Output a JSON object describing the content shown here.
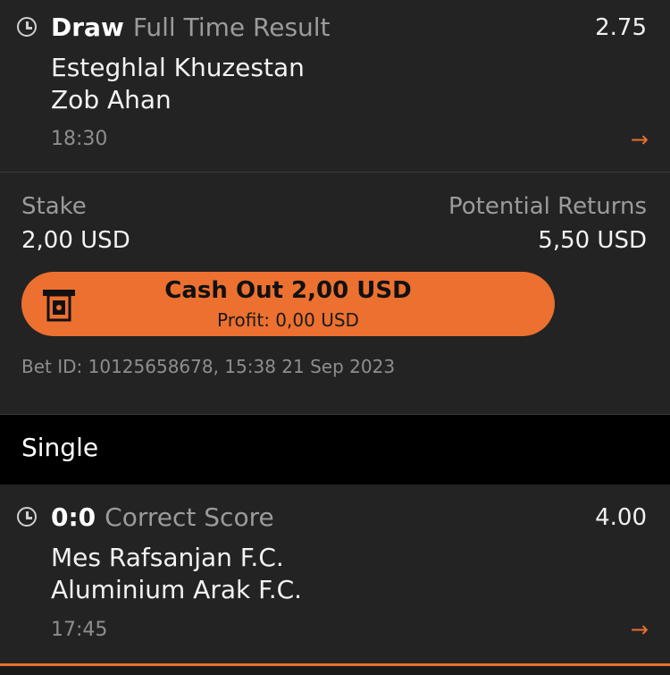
{
  "bet1": {
    "selection": "Draw",
    "market": "Full Time Result",
    "odds": "2.75",
    "team_home": "Esteghlal Khuzestan",
    "team_away": "Zob Ahan",
    "time": "18:30",
    "arrow": "→"
  },
  "summary": {
    "stake_label": "Stake",
    "stake_value": "2,00 USD",
    "returns_label": "Potential Returns",
    "returns_value": "5,50 USD",
    "cashout_label": "Cash Out 2,00 USD",
    "profit_label": "Profit: 0,00 USD",
    "bet_id": "Bet ID: 10125658678, 15:38 21 Sep 2023"
  },
  "section": {
    "title": "Single"
  },
  "bet2": {
    "selection": "0:0",
    "market": "Correct Score",
    "odds": "4.00",
    "team_home": "Mes Rafsanjan F.C.",
    "team_away": "Aluminium Arak F.C.",
    "time": "17:45",
    "arrow": "→"
  },
  "colors": {
    "accent": "#ec7030",
    "background": "#232323",
    "header": "#000000"
  },
  "icons": {
    "clock": "clock-icon",
    "arrow": "arrow-right-icon",
    "cashout": "cash-machine-icon"
  }
}
